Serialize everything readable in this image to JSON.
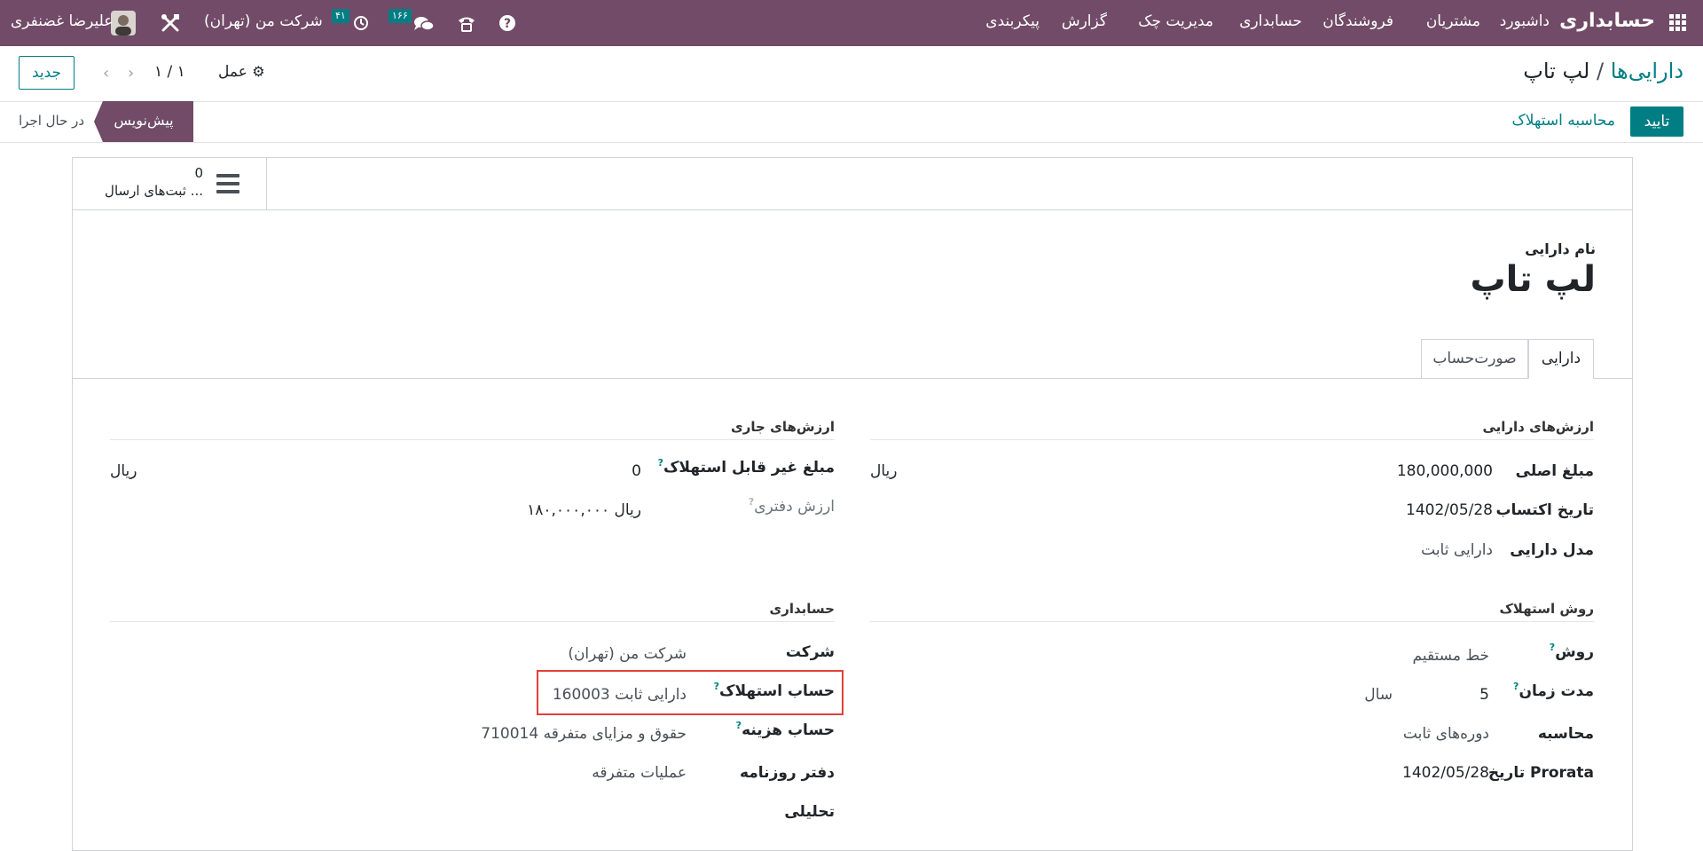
{
  "navbar": {
    "app_name": "حسابداری",
    "menu": [
      "داشبورد",
      "مشتریان",
      "فروشندگان",
      "حسابداری",
      "مدیریت چک",
      "گزارش",
      "پیکربندی"
    ],
    "company": "شرکت من (تهران)",
    "activity_count": "۴۱",
    "message_count": "۱۶۶",
    "user_name": "علیرضا غضنفری"
  },
  "control": {
    "breadcrumb_parent": "دارایی‌ها",
    "breadcrumb_sep": "/",
    "breadcrumb_current": "لپ تاپ",
    "action_label": "عمل",
    "pager": "۱ / ۱",
    "new_button": "جدید"
  },
  "statusbar": {
    "confirm_button": "تایید",
    "compute_button": "محاسبه استهلاک",
    "stage_draft": "پیش‌نویس",
    "stage_running": "در حال اجرا"
  },
  "smart_button": {
    "count": "0",
    "label": "ثبت‌های ارسال ..."
  },
  "form": {
    "name_label": "نام دارایی",
    "name_value": "لپ تاپ",
    "tabs": [
      "دارایی",
      "صورت‌حساب"
    ],
    "asset_values": {
      "title": "ارزش‌های دارایی",
      "original_value_label": "مبلغ اصلی",
      "original_value": "180,000,000",
      "currency": "ریال",
      "acquisition_date_label": "تاریخ اکتساب",
      "acquisition_date": "1402/05/28",
      "model_label": "مدل دارایی",
      "model_value": "دارایی ثابت"
    },
    "current_values": {
      "title": "ارزش‌های جاری",
      "non_depreciable_label": "مبلغ غیر قابل استهلاک",
      "non_depreciable_value": "0",
      "currency": "ریال",
      "book_value_label": "ارزش دفتری",
      "book_value": "۱۸۰,۰۰۰,۰۰۰ ریال"
    },
    "depreciation_method": {
      "title": "روش استهلاک",
      "method_label": "روش",
      "method_value": "خط مستقیم",
      "duration_label": "مدت زمان",
      "duration_value": "5",
      "duration_unit": "سال",
      "computation_label": "محاسبه",
      "computation_value": "دوره‌های ثابت",
      "prorata_label": "تاریخ Prorata",
      "prorata_value": "1402/05/28"
    },
    "accounting": {
      "title": "حسابداری",
      "company_label": "شرکت",
      "company_value": "شرکت من (تهران)",
      "depreciation_account_label": "حساب استهلاک",
      "depreciation_account_value": "160003 دارایی ثابت",
      "expense_account_label": "حساب هزینه",
      "expense_account_value": "710014 حقوق و مزایای متفرقه",
      "journal_label": "دفتر روزنامه",
      "journal_value": "عملیات متفرقه",
      "analytic_label": "تحلیلی"
    }
  },
  "colors": {
    "brand": "#714b67",
    "teal": "#017e84",
    "highlight": "#e0413a"
  }
}
